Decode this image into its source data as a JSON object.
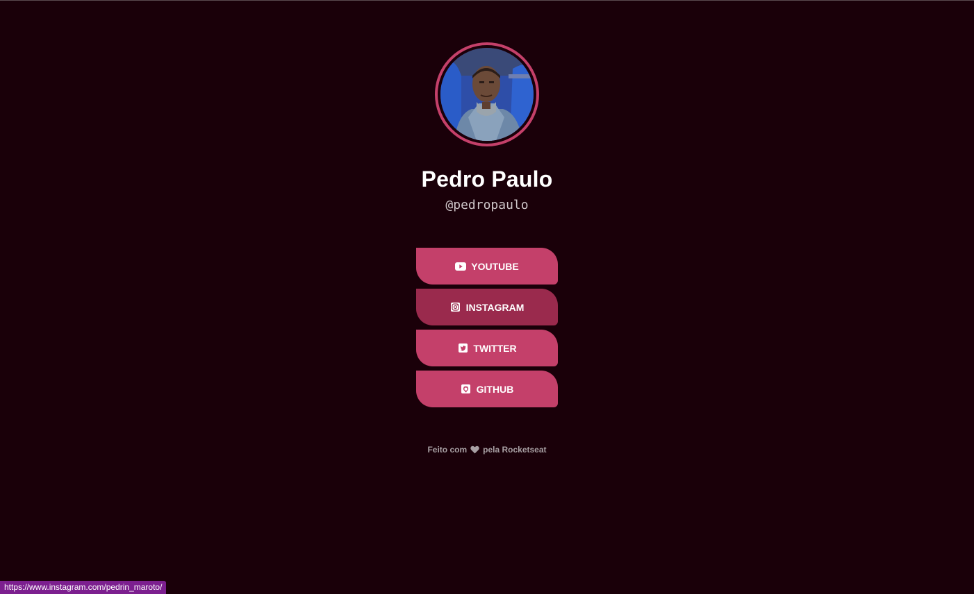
{
  "profile": {
    "name": "Pedro Paulo",
    "handle": "@pedropaulo"
  },
  "links": [
    {
      "label": "YOUTUBE",
      "icon": "youtube-icon"
    },
    {
      "label": "INSTAGRAM",
      "icon": "instagram-icon"
    },
    {
      "label": "TWITTER",
      "icon": "twitter-icon"
    },
    {
      "label": "GITHUB",
      "icon": "github-icon"
    }
  ],
  "footer": {
    "prefix": "Feito com",
    "suffix": "pela Rocketseat",
    "icon": "heart-icon"
  },
  "status_bar": {
    "url": "https://www.instagram.com/pedrin_maroto/"
  },
  "colors": {
    "background": "#1a0009",
    "accent": "#c4406a",
    "accent_hover": "#9a2a4d",
    "status_bar": "#7c1f8f"
  }
}
